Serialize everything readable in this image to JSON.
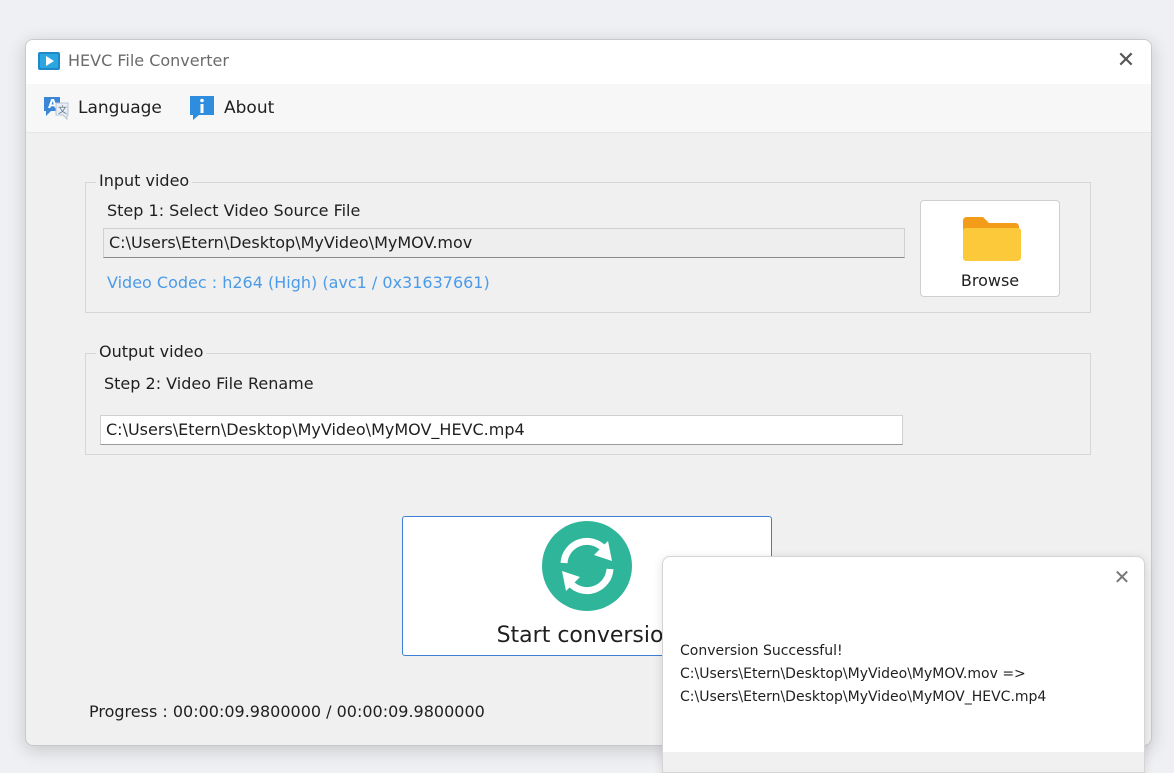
{
  "window": {
    "title": "HEVC File Converter"
  },
  "menu": {
    "language_label": "Language",
    "about_label": "About"
  },
  "input_group": {
    "title": "Input video",
    "step_label": "Step 1: Select Video Source File",
    "source_path": "C:\\Users\\Etern\\Desktop\\MyVideo\\MyMOV.mov",
    "codec_info": "Video Codec : h264 (High) (avc1 / 0x31637661)",
    "browse_label": "Browse"
  },
  "output_group": {
    "title": "Output video",
    "step_label": "Step 2: Video File Rename",
    "output_path": "C:\\Users\\Etern\\Desktop\\MyVideo\\MyMOV_HEVC.mp4"
  },
  "start_label": "Start conversion",
  "progress_text": "Progress : 00:00:09.9800000 / 00:00:09.9800000",
  "notification": {
    "line1": "Conversion Successful!",
    "line2": " C:\\Users\\Etern\\Desktop\\MyVideo\\MyMOV.mov =>",
    "line3": "C:\\Users\\Etern\\Desktop\\MyVideo\\MyMOV_HEVC.mp4"
  },
  "icons": {
    "app": "video-play-icon",
    "language": "translate-icon",
    "about": "info-icon",
    "browse": "folder-icon",
    "start": "refresh-icon",
    "close": "close-icon"
  },
  "colors": {
    "accent_blue": "#3d7fd6",
    "codec_text": "#4b9be8",
    "start_icon_green": "#2fb59a",
    "folder_orange": "#f7a823"
  }
}
